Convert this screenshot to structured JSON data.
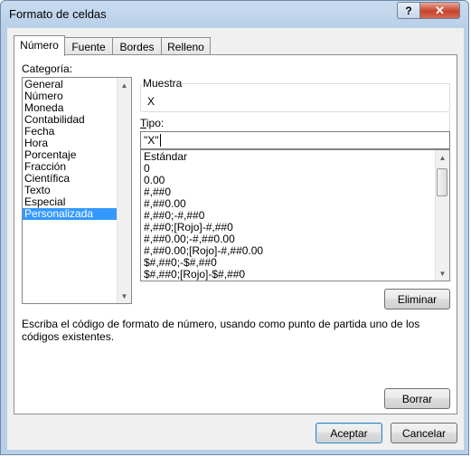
{
  "window": {
    "title": "Formato de celdas",
    "help_label": "?",
    "close_label": "✕"
  },
  "tabs": [
    {
      "label": "Número",
      "active": true
    },
    {
      "label": "Fuente",
      "active": false
    },
    {
      "label": "Bordes",
      "active": false
    },
    {
      "label": "Relleno",
      "active": false
    }
  ],
  "category": {
    "label": "Categoría:",
    "items": [
      "General",
      "Número",
      "Moneda",
      "Contabilidad",
      "Fecha",
      "Hora",
      "Porcentaje",
      "Fracción",
      "Científica",
      "Texto",
      "Especial",
      "Personalizada"
    ],
    "selected": "Personalizada"
  },
  "sample": {
    "label": "Muestra",
    "value": "X"
  },
  "type": {
    "label": "Tipo:",
    "value": "\"X\"",
    "formats": [
      "Estándar",
      "0",
      "0.00",
      "#,##0",
      "#,##0.00",
      "#,##0;-#,##0",
      "#,##0;[Rojo]-#,##0",
      "#,##0.00;-#,##0.00",
      "#,##0.00;[Rojo]-#,##0.00",
      "$#,##0;-$#,##0",
      "$#,##0;[Rojo]-$#,##0"
    ]
  },
  "delete_button": "Eliminar",
  "description": "Escriba el código de formato de número, usando como punto de partida uno de los códigos existentes.",
  "clear_button": "Borrar",
  "ok_button": "Aceptar",
  "cancel_button": "Cancelar",
  "icons": {
    "scroll_up": "▲",
    "scroll_down": "▼"
  }
}
